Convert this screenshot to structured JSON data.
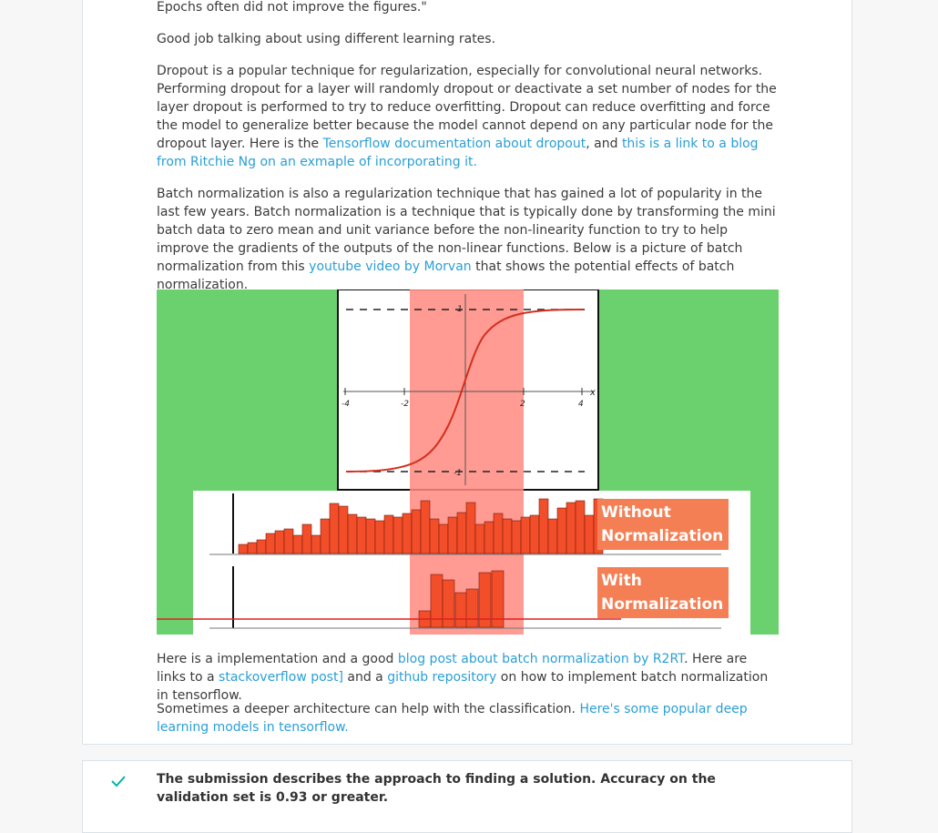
{
  "review": {
    "p0": "Epochs often did not improve the figures.\"",
    "p1": "Good job talking about using different learning rates.",
    "p2_text1": "Dropout is a popular technique for regularization, especially for convolutional neural networks. Performing dropout for a layer will randomly dropout or deactivate a set number of nodes for the layer dropout is performed to try to reduce overfitting. Dropout can reduce overfitting and force the model to generalize better because the model cannot depend on any particular node for the dropout layer. Here is the ",
    "p2_link1": "Tensorflow documentation about dropout",
    "p2_text2": ", and ",
    "p2_link2": "this is a link to a blog from Ritchie Ng on an exmaple of incorporating it.",
    "p3_text1": "Batch normalization is also a regularization technique that has gained a lot of popularity in the last few years. Batch normalization is a technique that is typically done by transforming the mini batch data to zero mean and unit variance before the non-linearity function to try to help improve the gradients of the outputs of the non-linear functions. Below is a picture of batch normalization from this ",
    "p3_link1": "youtube video by Morvan",
    "p3_text2": " that shows the potential effects of batch normalization.",
    "p4_text1": "Here is a implementation and a good ",
    "p4_link1": "blog post about batch normalization by R2RT",
    "p4_text2": ". Here are links to a ",
    "p4_link2": "stackoverflow post]",
    "p4_text3": " and a ",
    "p4_link3": "github repository",
    "p4_text4": " on how to implement batch normalization in tensorflow.",
    "p5_text1": "Sometimes a deeper architecture can help with the classification. ",
    "p5_link1": "Here's some popular deep learning models in tensorflow."
  },
  "figure": {
    "label_without_1": "Without",
    "label_without_2": "Normalization",
    "label_with_1": "With",
    "label_with_2": "Normalization",
    "ticks_x": [
      "-4",
      "-2",
      "2",
      "4"
    ],
    "tick_y_top": "1",
    "tick_y_bottom": "-1",
    "axis_x": "x",
    "colors": {
      "background": "#6bd06e",
      "band": "#ff8a80",
      "bars": "#f24e2a",
      "label_bg": "#f57f54"
    }
  },
  "criterion": {
    "icon": "check-icon",
    "text": "The submission describes the approach to finding a solution. Accuracy on the validation set is 0.93 or greater."
  }
}
